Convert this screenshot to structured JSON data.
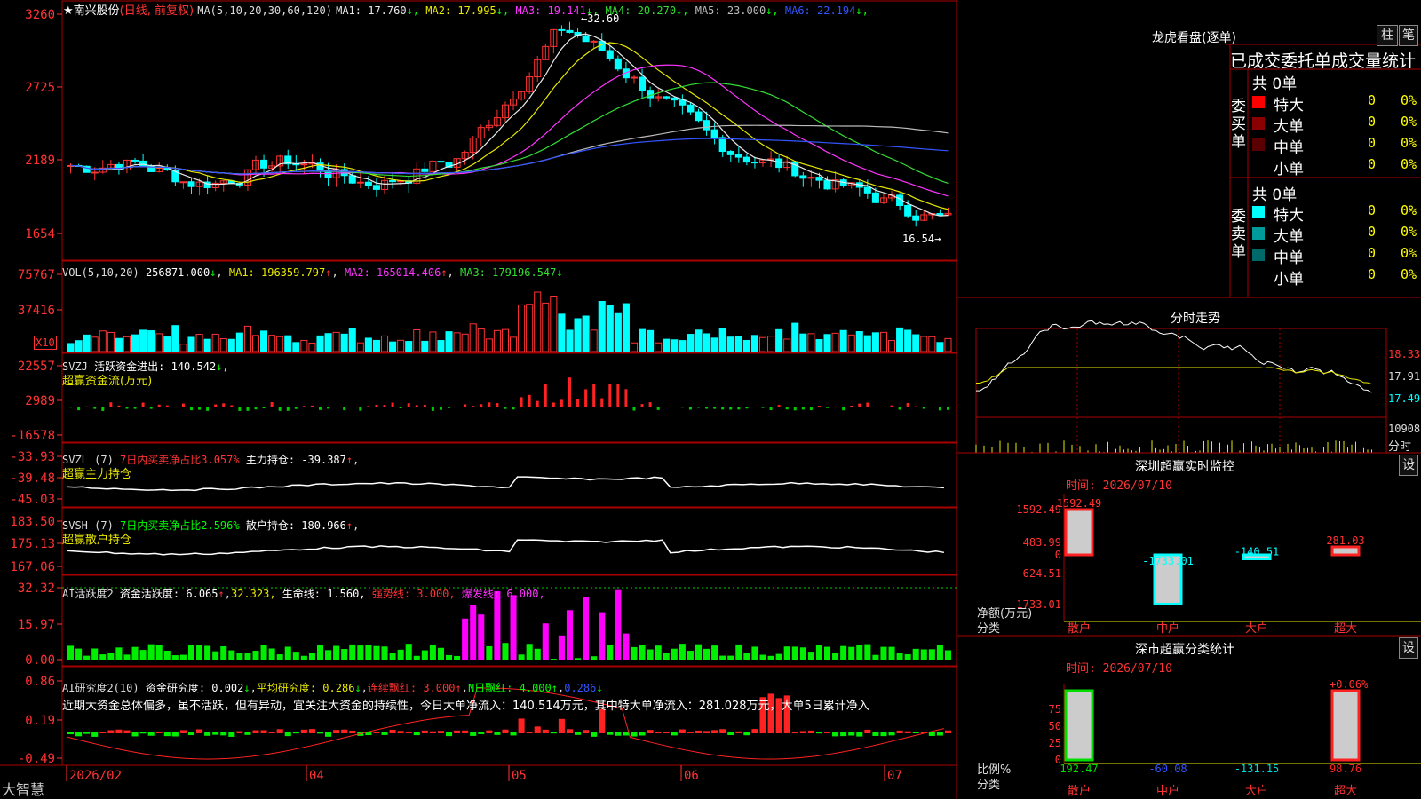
{
  "chart": {
    "stock_name": "南兴股份",
    "mode": "(日线, 前复权)",
    "ma_header": "MA(5,10,20,30,60,120)",
    "mas": [
      {
        "label": "MA1: 17.760",
        "arrow": "↓",
        "color": "#e8e8e8"
      },
      {
        "label": "MA2: 17.995",
        "arrow": "↓",
        "color": "#e8e800"
      },
      {
        "label": "MA3: 19.141",
        "arrow": "↓",
        "color": "#ff33ff"
      },
      {
        "label": "MA4: 20.270",
        "arrow": "↓",
        "color": "#33dd33"
      },
      {
        "label": "MA5: 23.000",
        "arrow": "↓",
        "color": "#bbbbbb"
      },
      {
        "label": "MA6: 22.194",
        "arrow": "↓",
        "color": "#3355ff"
      }
    ],
    "high_marker": "32.60",
    "low_marker": "16.54",
    "y_ticks": [
      "3260",
      "2725",
      "2189",
      "1654"
    ]
  },
  "vol": {
    "header": "VOL(5,10,20)",
    "value": "256871.000",
    "ma1": "MA1: 196359.797",
    "ma2": "MA2: 165014.406",
    "ma3": "MA3: 179196.547",
    "y_ticks": [
      "75767",
      "37416"
    ],
    "unit_badge": "X10"
  },
  "svzj": {
    "header": "SVZJ",
    "label": "活跃资金进出: 140.542",
    "subtitle": "超赢资金流(万元)",
    "y_ticks": [
      "22557",
      "2989",
      "-16578"
    ]
  },
  "svzl": {
    "header": "SVZL (7)",
    "ratio": "7日内买卖净占比3.057%",
    "label": "主力持仓: -39.387",
    "subtitle": "超赢主力持仓",
    "y_ticks": [
      "-33.93",
      "-39.48",
      "-45.03"
    ]
  },
  "svsh": {
    "header": "SVSH (7)",
    "ratio": "7日内买卖净占比2.596%",
    "label": "散户持仓: 180.966",
    "subtitle": "超赢散户持仓",
    "y_ticks": [
      "183.50",
      "175.13",
      "167.06"
    ]
  },
  "ai1": {
    "header": "AI活跃度2",
    "label": "资金活跃度: 6.065",
    "v2": "32.323,",
    "life": "生命线: 1.560,",
    "strong": "强势线: 3.000,",
    "burst": "爆发线: 6.000,",
    "y_ticks": [
      "32.32",
      "15.97",
      "0.00"
    ]
  },
  "ai2": {
    "header": "AI研究度2(10)",
    "label": "资金研究度: 0.002",
    "avg": "平均研究度: 0.286",
    "cont": "连续飘红: 3.000",
    "nday": "N日飘红: 4.000",
    "last": "0.286",
    "comment": "近期大资金总体偏多，虽不活跃，但有异动，宜关注大资金的持续性，今日大单净流入：140.514万元，其中特大单净流入：281.028万元，大单5日累计净入",
    "y_ticks": [
      "0.86",
      "0.19",
      "-0.49"
    ]
  },
  "xaxis": {
    "labels": [
      "2026/02",
      "04",
      "05",
      "06",
      "07"
    ]
  },
  "brand": "大智慧",
  "right": {
    "lhb_title": "龙虎看盘(逐单)",
    "btn_zhu": "柱",
    "btn_bi": "笔",
    "panel_title": "已成交委托单成交量统计",
    "buy_group": "委买单",
    "sell_group": "委卖单",
    "buy_total": "共 0单",
    "sell_total": "共 0单",
    "buy_rows": [
      {
        "name": "特大",
        "count": "0",
        "pct": "0%",
        "color": "#ff0000"
      },
      {
        "name": "大单",
        "count": "0",
        "pct": "0%",
        "color": "#8b0000"
      },
      {
        "name": "中单",
        "count": "0",
        "pct": "0%",
        "color": "#5a0000"
      },
      {
        "name": "小单",
        "count": "0",
        "pct": "0%",
        "color": "#000000"
      }
    ],
    "sell_rows": [
      {
        "name": "特大",
        "count": "0",
        "pct": "0%",
        "color": "#00ffff"
      },
      {
        "name": "大单",
        "count": "0",
        "pct": "0%",
        "color": "#009a9a"
      },
      {
        "name": "中单",
        "count": "0",
        "pct": "0%",
        "color": "#006a6a"
      },
      {
        "name": "小单",
        "count": "0",
        "pct": "0%",
        "color": "#000000"
      }
    ],
    "fenshi_title": "分时走势",
    "fenshi_prices": [
      "18.33",
      "17.91",
      "17.49"
    ],
    "fenshi_vol": "10908",
    "fenshi_vol_lbl": "分时",
    "sz_title": "深圳超赢实时监控",
    "sz_btn": "设",
    "sz_time": "时间: 2026/07/10",
    "sz_y": [
      "1592.49",
      "483.99",
      "0",
      "-624.51",
      "-1733.01"
    ],
    "sz_axis_lbl": "净额(万元)",
    "sz_cat_lbl": "分类",
    "sz_bars": [
      {
        "cat": "散户",
        "value": 1592.49,
        "label": "1592.49"
      },
      {
        "cat": "中户",
        "value": -1733.01,
        "label": "-1733.01"
      },
      {
        "cat": "大户",
        "value": -140.51,
        "label": "-140.51"
      },
      {
        "cat": "超大",
        "value": 281.03,
        "label": "281.03"
      }
    ],
    "ss_title": "深市超赢分类统计",
    "ss_btn": "设",
    "ss_time": "时间: 2026/07/10",
    "ss_y": [
      "75",
      "50",
      "25",
      "0"
    ],
    "ss_axis_lbl": "比例%",
    "ss_cat_lbl": "分类",
    "ss_top": "+0.06%",
    "ss_bars": [
      {
        "cat": "散户",
        "pct": 100,
        "label": "192.47",
        "color": "#00dd00"
      },
      {
        "cat": "中户",
        "pct": 0,
        "label": "-60.08",
        "color": "#3355ff"
      },
      {
        "cat": "大户",
        "pct": 0,
        "label": "-131.15",
        "color": "#00dddd"
      },
      {
        "cat": "超大",
        "pct": 100,
        "label": "98.76",
        "color": "#ff2222"
      }
    ]
  }
}
